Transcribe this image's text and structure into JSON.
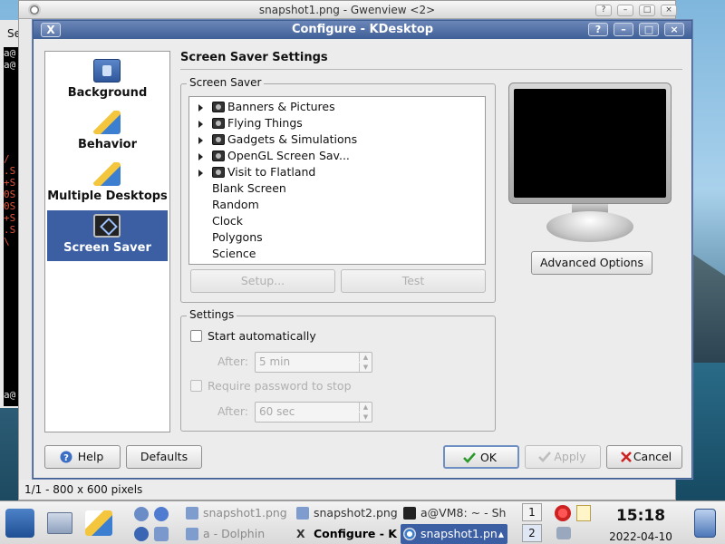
{
  "terminal": {
    "top_label": "Se",
    "lines": [
      "a@",
      "a@",
      "",
      "",
      "",
      "",
      "",
      "",
      "",
      "/",
      ".S",
      "+S",
      "0S",
      "0S",
      "+S",
      ".S",
      "\\",
      "",
      "",
      "",
      "",
      "",
      "",
      "",
      "",
      "",
      "",
      "",
      "",
      "a@"
    ]
  },
  "gwenview": {
    "title": "snapshot1.png - Gwenview <2>",
    "status": "1/1 - 800 x 600 pixels"
  },
  "dialog": {
    "title": "Configure - KDesktop",
    "window_buttons": [
      "?",
      "–",
      "□",
      "×"
    ],
    "modules": [
      {
        "label": "Background",
        "icon": "background-icon"
      },
      {
        "label": "Behavior",
        "icon": "behavior-icon"
      },
      {
        "label": "Multiple Desktops",
        "icon": "multiple-desktops-icon"
      },
      {
        "label": "Screen Saver",
        "icon": "screen-saver-icon",
        "selected": true
      }
    ],
    "page_title": "Screen Saver Settings",
    "screen_saver_group": "Screen Saver",
    "tree": [
      {
        "label": "Banners & Pictures",
        "category": true
      },
      {
        "label": "Flying Things",
        "category": true
      },
      {
        "label": "Gadgets & Simulations",
        "category": true
      },
      {
        "label": "OpenGL Screen Sav...",
        "category": true
      },
      {
        "label": "Visit to Flatland",
        "category": true
      },
      {
        "label": "Blank Screen",
        "category": false
      },
      {
        "label": "Random",
        "category": false
      },
      {
        "label": "Clock",
        "category": false
      },
      {
        "label": "Polygons",
        "category": false
      },
      {
        "label": "Science",
        "category": false
      }
    ],
    "setup_button": "Setup...",
    "test_button": "Test",
    "advanced_button": "Advanced Options",
    "settings_group": "Settings",
    "start_auto": {
      "label": "Start automatically",
      "checked": false
    },
    "after1": {
      "label": "After:",
      "value": "5 min"
    },
    "require_password": {
      "label": "Require password to stop",
      "checked": false
    },
    "after2": {
      "label": "After:",
      "value": "60 sec"
    },
    "help_button": "Help",
    "defaults_button": "Defaults",
    "ok_button": "OK",
    "apply_button": "Apply",
    "cancel_button": "Cancel"
  },
  "taskbar": {
    "tasks": [
      {
        "label": "snapshot1.png",
        "icon": "image-icon",
        "state": "dim"
      },
      {
        "label": "snapshot2.png",
        "icon": "image-icon",
        "state": "normal"
      },
      {
        "label": "a@VM8: ~ - Sh",
        "icon": "terminal-icon",
        "state": "normal"
      },
      {
        "label": "a - Dolphin",
        "icon": "folder-icon",
        "state": "dim"
      },
      {
        "label": "Configure - K",
        "icon": "kde-x-icon",
        "state": "active"
      },
      {
        "label": "snapshot1.pn",
        "icon": "gwenview-icon",
        "state": "selected"
      }
    ],
    "pager": [
      "1",
      "2"
    ],
    "clock": "15:18",
    "date": "2022-04-10"
  },
  "colors": {
    "accent": "#3c5fa3",
    "title_bar": "#4f6ea5",
    "ok_check": "#2a9a2a",
    "cancel_x": "#cc2222"
  }
}
